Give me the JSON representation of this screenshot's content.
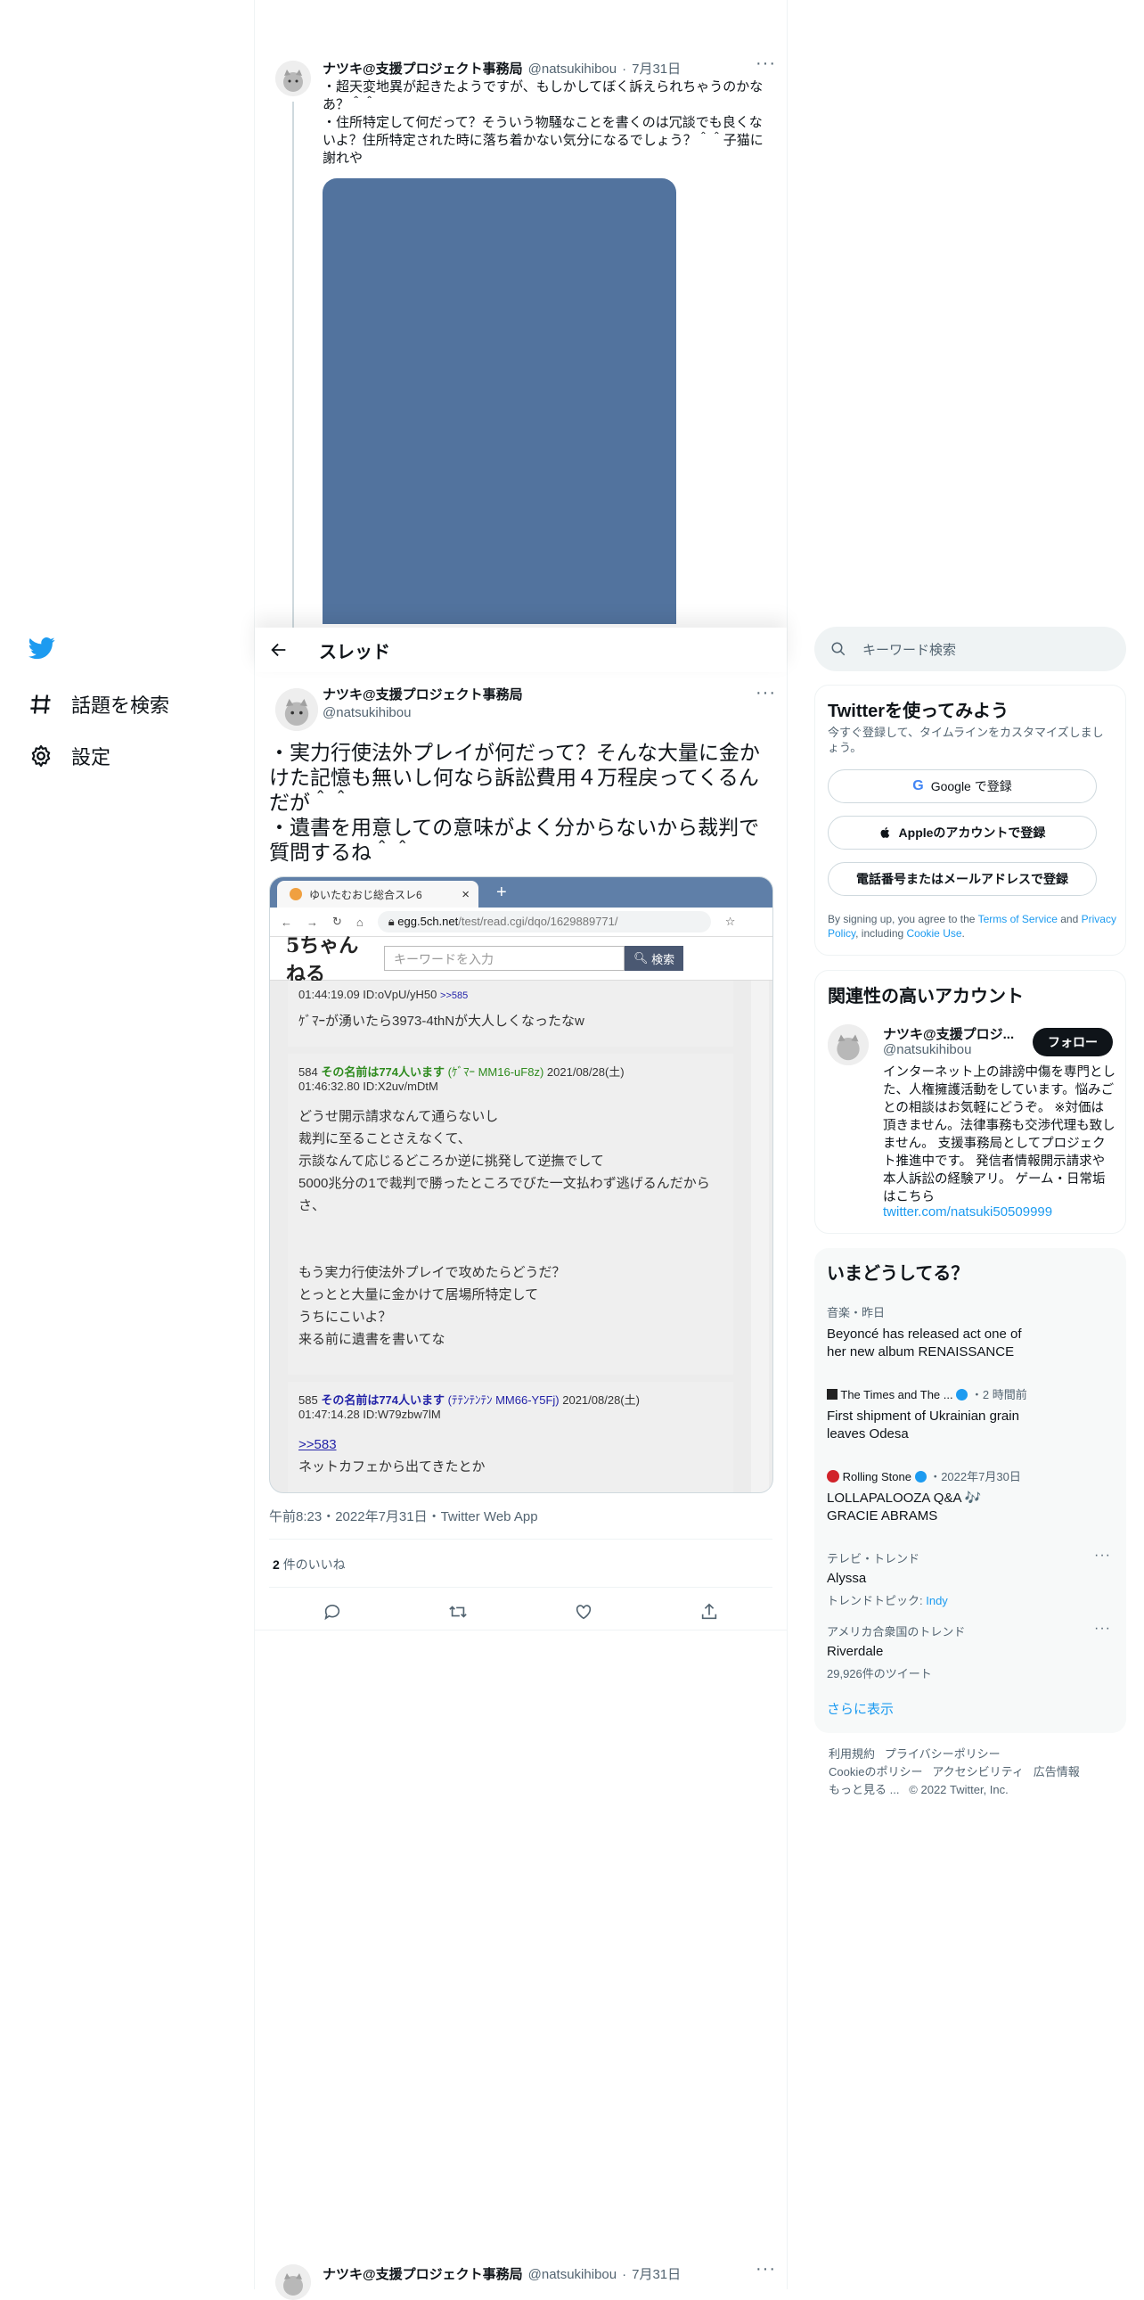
{
  "nav": {
    "explore": "話題を検索",
    "settings": "設定"
  },
  "thread_header": {
    "title": "スレッド"
  },
  "context_tweet": {
    "name": "ナツキ@支援プロジェクト事務局",
    "handle": "@natsukihibou",
    "date": "7月31日",
    "line1": "・超天変地異が起きたようですが、もしかしてぼく訴えられちゃうのかなあ？＾＾",
    "line2": "・住所特定して何だって？そういう物騒なことを書くのは冗談でも良くないよ？住所特定された時に落ち着かない気分になるでしょう？＾＾子猫に謝れや"
  },
  "main_tweet": {
    "name": "ナツキ@支援プロジェクト事務局",
    "handle": "@natsukihibou",
    "text1": "・実力行使法外プレイが何だって？そんな大量に金かけた記憶も無いし何なら訴訟費用４万程戻ってくるんだが＾＾",
    "text2": "・遺書を用意しての意味がよく分からないから裁判で質問するね＾＾",
    "timestamp": "午前8:23・2022年7月31日・Twitter Web App",
    "likes_count": "2",
    "likes_label": "件のいいね"
  },
  "screenshot": {
    "tab_title": "ゆいたむおじ総合スレ6",
    "url_domain": "egg.5ch.net",
    "url_path": "/test/read.cgi/dqo/1629889771/",
    "site_logo": "5ちゃんねる",
    "search_placeholder": "キーワードを入力",
    "search_button": "検索",
    "post0_meta": "01:44:19.09 ID:oVpU/yH50",
    "post0_ref": ">>585",
    "post0_body": "ｹﾞﾏｰが湧いたら3973-4thNが大人しくなったなw",
    "post1_num": "584",
    "post1_name": "その名前は774人います",
    "post1_trip": "(ｹﾞﾏｰ MM16-uF8z)",
    "post1_date": "2021/08/28(土)",
    "post1_time": "01:46:32.80 ID:X2uv/mDtM",
    "post1_lines": [
      "どうせ開示請求なんて通らないし",
      "裁判に至ることさえなくて、",
      "示談なんて応じるどころか逆に挑発して逆撫でして",
      "5000兆分の1で裁判で勝ったところでびた一文払わず逃げるんだからさ、",
      "",
      "",
      "もう実力行使法外プレイで攻めたらどうだ？",
      "とっとと大量に金かけて居場所特定して",
      "うちにこいよ？",
      "来る前に遺書を書いてな"
    ],
    "post2_num": "585",
    "post2_name": "その名前は774人います",
    "post2_trip": "(ﾃﾃﾝﾃﾝﾃﾝ MM66-Y5Fj)",
    "post2_date": "2021/08/28(土)",
    "post2_time": "01:47:14.28 ID:W79zbw7lM",
    "post2_ref": ">>583",
    "post2_body": "ネットカフェから出てきたとか"
  },
  "search": {
    "placeholder": "キーワード検索"
  },
  "signup": {
    "title": "Twitterを使ってみよう",
    "subtitle": "今すぐ登録して、タイムラインをカスタマイズしましょう。",
    "google": "Google で登録",
    "apple": "Appleのアカウントで登録",
    "phone": "電話番号またはメールアドレスで登録",
    "legal_pre": "By signing up, you agree to the ",
    "terms": "Terms of Service",
    "and": " and ",
    "privacy": "Privacy Policy",
    "including": ", including ",
    "cookie": "Cookie Use",
    "period": "."
  },
  "relevant": {
    "title": "関連性の高いアカウント",
    "name": "ナツキ@支援プロジ...",
    "handle": "@natsukihibou",
    "follow": "フォロー",
    "bio": "インターネット上の誹謗中傷を専門とした、人権擁護活動をしています。悩みごとの相談はお気軽にどうぞ。 ※対価は頂きません。法律事務も交渉代理も致しません。 支援事務局としてプロジェクト推進中です。 発信者情報開示請求や本人訴訟の経験アリ。 ゲーム・日常垢はこちら",
    "link": "twitter.com/natsuki50509999"
  },
  "trends": {
    "title": "いまどうしてる？",
    "items": [
      {
        "category": "音楽・昨日",
        "title": "Beyoncé has released act one of her new album RENAISSANCE"
      },
      {
        "category": "The Times and The ...",
        "time": "・2 時間前",
        "title": "First shipment of Ukrainian grain leaves Odesa"
      },
      {
        "category": "Rolling Stone",
        "time": "・2022年7月30日",
        "title": "LOLLAPALOOZA Q&A 🎶 GRACIE ABRAMS"
      },
      {
        "category": "テレビ・トレンド",
        "title": "Alyssa",
        "sub_label": "トレンドトピック: ",
        "sub_link": "Indy"
      },
      {
        "category": "アメリカ合衆国のトレンド",
        "title": "Riverdale",
        "sub_label": "29,926件のツイート"
      }
    ],
    "show_more": "さらに表示"
  },
  "footer": {
    "terms": "利用規約",
    "privacy": "プライバシーポリシー",
    "cookie": "Cookieのポリシー",
    "accessibility": "アクセシビリティ",
    "ads": "広告情報",
    "more": "もっと見る ...",
    "copyright": "© 2022 Twitter, Inc."
  },
  "colors": {
    "accent": "#1d9bf0",
    "image_placeholder": "#52739e",
    "shot_tabbar": "#5f7fa8"
  }
}
